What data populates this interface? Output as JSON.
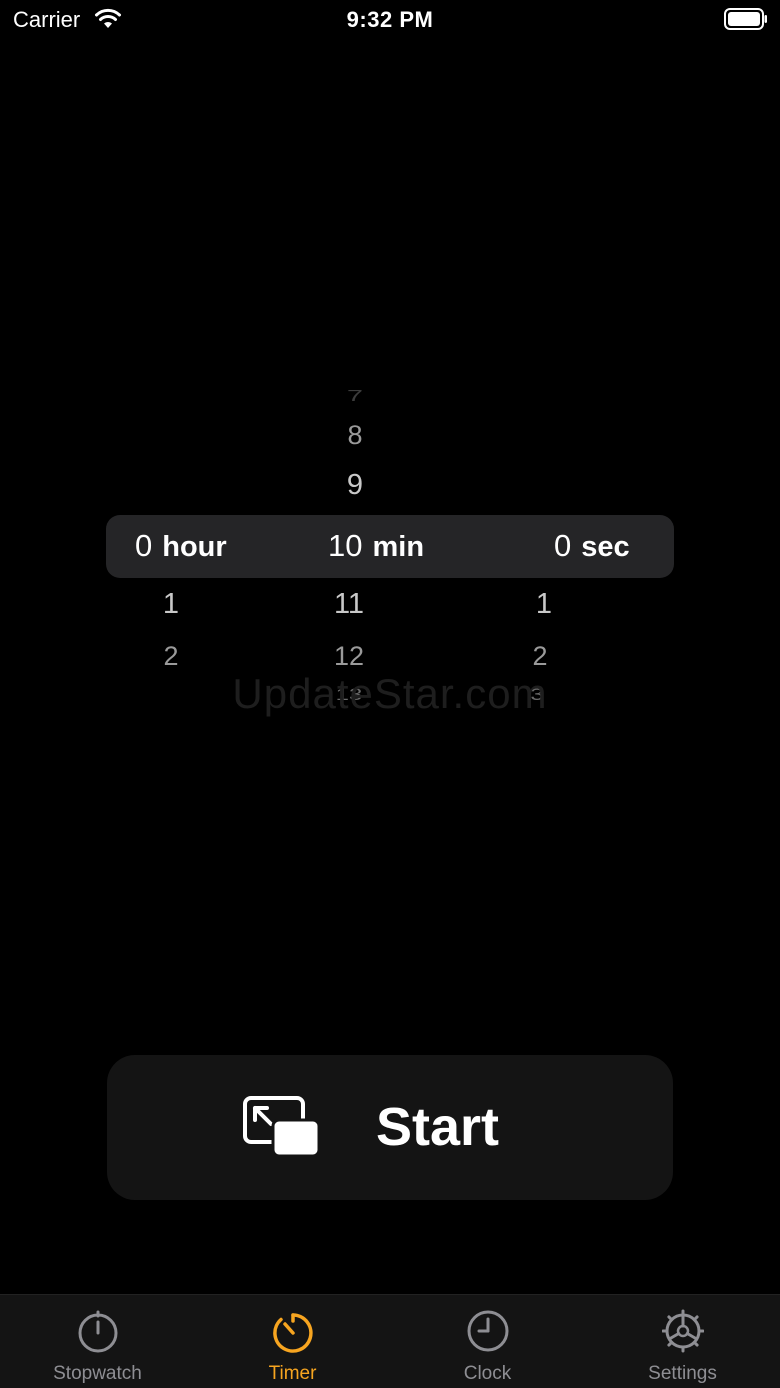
{
  "status_bar": {
    "carrier": "Carrier",
    "time": "9:32 PM"
  },
  "picker": {
    "hour": {
      "above": [
        "",
        ""
      ],
      "selected": "0",
      "unit": "hour",
      "below": [
        "1",
        "2"
      ]
    },
    "min": {
      "above": [
        "7",
        "8",
        "9"
      ],
      "selected": "10",
      "unit": "min",
      "below": [
        "11",
        "12",
        "13"
      ]
    },
    "sec": {
      "above": [
        "",
        ""
      ],
      "selected": "0",
      "unit": "sec",
      "below": [
        "1",
        "2",
        "3"
      ]
    }
  },
  "watermark": "UpdateStar.com",
  "start_button": {
    "label": "Start",
    "icon": "picture-in-picture-icon"
  },
  "tab_bar": {
    "active_color": "#F7A520",
    "inactive_color": "#8E8E93",
    "tabs": [
      {
        "label": "Stopwatch",
        "icon": "stopwatch-icon",
        "active": false
      },
      {
        "label": "Timer",
        "icon": "timer-icon",
        "active": true
      },
      {
        "label": "Clock",
        "icon": "clock-icon",
        "active": false
      },
      {
        "label": "Settings",
        "icon": "settings-icon",
        "active": false
      }
    ]
  }
}
